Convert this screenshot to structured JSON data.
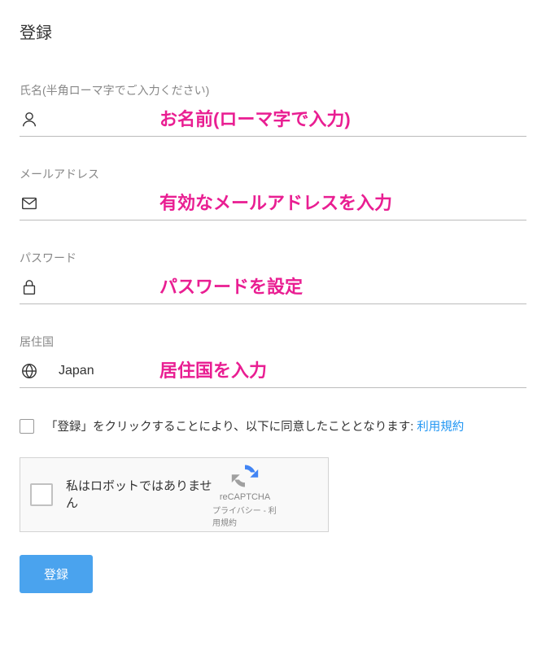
{
  "title": "登録",
  "fields": {
    "name": {
      "label": "氏名(半角ローマ字でご入力ください)",
      "value": "",
      "annotation": "お名前(ローマ字で入力)"
    },
    "email": {
      "label": "メールアドレス",
      "value": "",
      "annotation": "有効なメールアドレスを入力"
    },
    "password": {
      "label": "パスワード",
      "value": "",
      "annotation": "パスワードを設定"
    },
    "country": {
      "label": "居住国",
      "value": "Japan",
      "annotation": "居住国を入力"
    }
  },
  "agreement": {
    "text": "「登録」をクリックすることにより、以下に同意したこととなります: ",
    "link_text": "利用規約"
  },
  "recaptcha": {
    "label": "私はロボットではありません",
    "brand": "reCAPTCHA",
    "privacy": "プライバシー",
    "terms": "利用規約"
  },
  "submit": "登録"
}
